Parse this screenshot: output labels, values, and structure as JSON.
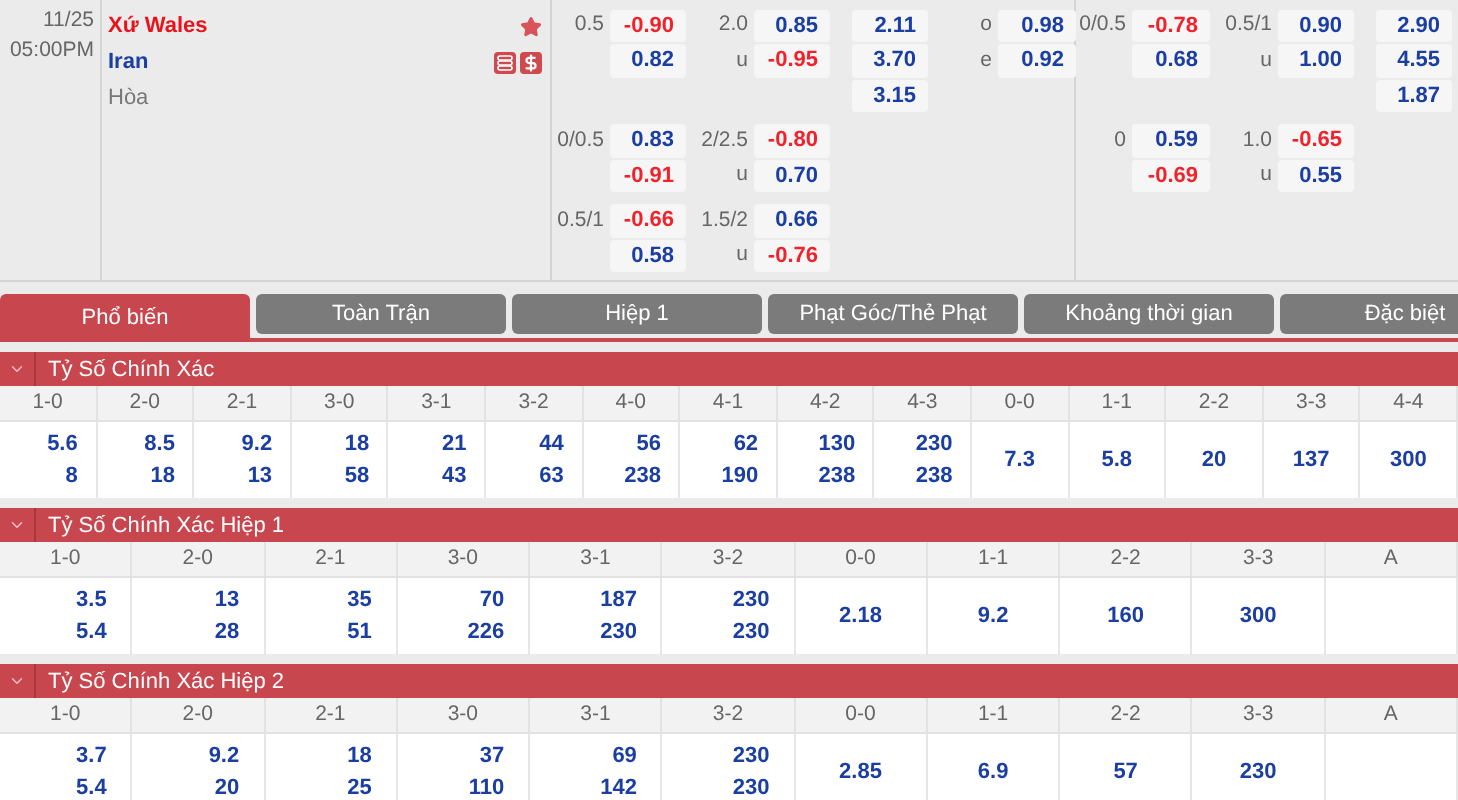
{
  "match": {
    "date": "11/25",
    "time": "05:00PM",
    "entries": [
      {
        "kind": "team",
        "name": "Xứ Wales",
        "color": "#e8141c"
      },
      {
        "kind": "team",
        "name": "Iran",
        "color": "#1b3ea3"
      },
      {
        "kind": "draw",
        "name": "Hòa",
        "color": "#777777"
      }
    ]
  },
  "full_time": {
    "groups": [
      {
        "handicap": {
          "line": "0.5",
          "odds": [
            {
              "value": "-0.90",
              "negative": true
            },
            {
              "value": "0.82",
              "negative": false
            }
          ]
        },
        "total": {
          "line": "2.0",
          "under": "u",
          "odds": [
            {
              "value": "0.85",
              "negative": false
            },
            {
              "value": "-0.95",
              "negative": true
            }
          ]
        },
        "one_x_two": [
          {
            "value": "2.11",
            "negative": false
          },
          {
            "value": "3.70",
            "negative": false
          },
          {
            "value": "3.15",
            "negative": false
          }
        ],
        "odd_even": [
          {
            "label": "o",
            "value": "0.98",
            "negative": false
          },
          {
            "label": "e",
            "value": "0.92",
            "negative": false
          }
        ]
      },
      {
        "handicap": {
          "line": "0/0.5",
          "odds": [
            {
              "value": "0.83",
              "negative": false
            },
            {
              "value": "-0.91",
              "negative": true
            }
          ]
        },
        "total": {
          "line": "2/2.5",
          "under": "u",
          "odds": [
            {
              "value": "-0.80",
              "negative": true
            },
            {
              "value": "0.70",
              "negative": false
            }
          ]
        }
      },
      {
        "handicap": {
          "line": "0.5/1",
          "odds": [
            {
              "value": "-0.66",
              "negative": true
            },
            {
              "value": "0.58",
              "negative": false
            }
          ]
        },
        "total": {
          "line": "1.5/2",
          "under": "u",
          "odds": [
            {
              "value": "0.66",
              "negative": false
            },
            {
              "value": "-0.76",
              "negative": true
            }
          ]
        }
      }
    ]
  },
  "first_half": {
    "groups": [
      {
        "handicap": {
          "line": "0/0.5",
          "odds": [
            {
              "value": "-0.78",
              "negative": true
            },
            {
              "value": "0.68",
              "negative": false
            }
          ]
        },
        "total": {
          "line": "0.5/1",
          "under": "u",
          "odds": [
            {
              "value": "0.90",
              "negative": false
            },
            {
              "value": "1.00",
              "negative": false
            }
          ]
        },
        "one_x_two": [
          {
            "value": "2.90",
            "negative": false
          },
          {
            "value": "4.55",
            "negative": false
          },
          {
            "value": "1.87",
            "negative": false
          }
        ]
      },
      {
        "handicap": {
          "line": "0",
          "odds": [
            {
              "value": "0.59",
              "negative": false
            },
            {
              "value": "-0.69",
              "negative": true
            }
          ]
        },
        "total": {
          "line": "1.0",
          "under": "u",
          "odds": [
            {
              "value": "-0.65",
              "negative": true
            },
            {
              "value": "0.55",
              "negative": false
            }
          ]
        }
      }
    ]
  },
  "tabs": [
    {
      "label": "Phổ biến",
      "selected": true
    },
    {
      "label": "Toàn Trận",
      "selected": false
    },
    {
      "label": "Hiệp 1",
      "selected": false
    },
    {
      "label": "Phạt Góc/Thẻ Phạt",
      "selected": false
    },
    {
      "label": "Khoảng thời gian",
      "selected": false
    },
    {
      "label": "Đặc biệt",
      "selected": false
    }
  ],
  "sections": [
    {
      "title": "Tỷ Số Chính Xác",
      "expanded": true,
      "columns": [
        {
          "label": "1-0",
          "values": [
            "5.6",
            "8"
          ]
        },
        {
          "label": "2-0",
          "values": [
            "8.5",
            "18"
          ]
        },
        {
          "label": "2-1",
          "values": [
            "9.2",
            "13"
          ]
        },
        {
          "label": "3-0",
          "values": [
            "18",
            "58"
          ]
        },
        {
          "label": "3-1",
          "values": [
            "21",
            "43"
          ]
        },
        {
          "label": "3-2",
          "values": [
            "44",
            "63"
          ]
        },
        {
          "label": "4-0",
          "values": [
            "56",
            "238"
          ]
        },
        {
          "label": "4-1",
          "values": [
            "62",
            "190"
          ]
        },
        {
          "label": "4-2",
          "values": [
            "130",
            "238"
          ]
        },
        {
          "label": "4-3",
          "values": [
            "230",
            "238"
          ]
        },
        {
          "label": "0-0",
          "values": [
            "7.3"
          ]
        },
        {
          "label": "1-1",
          "values": [
            "5.8"
          ]
        },
        {
          "label": "2-2",
          "values": [
            "20"
          ]
        },
        {
          "label": "3-3",
          "values": [
            "137"
          ]
        },
        {
          "label": "4-4",
          "values": [
            "300"
          ]
        }
      ]
    },
    {
      "title": "Tỷ Số Chính Xác Hiệp 1",
      "expanded": true,
      "columns": [
        {
          "label": "1-0",
          "values": [
            "3.5",
            "5.4"
          ]
        },
        {
          "label": "2-0",
          "values": [
            "13",
            "28"
          ]
        },
        {
          "label": "2-1",
          "values": [
            "35",
            "51"
          ]
        },
        {
          "label": "3-0",
          "values": [
            "70",
            "226"
          ]
        },
        {
          "label": "3-1",
          "values": [
            "187",
            "230"
          ]
        },
        {
          "label": "3-2",
          "values": [
            "230",
            "230"
          ]
        },
        {
          "label": "0-0",
          "values": [
            "2.18"
          ]
        },
        {
          "label": "1-1",
          "values": [
            "9.2"
          ]
        },
        {
          "label": "2-2",
          "values": [
            "160"
          ]
        },
        {
          "label": "3-3",
          "values": [
            "300"
          ]
        },
        {
          "label": "A"
        }
      ]
    },
    {
      "title": "Tỷ Số Chính Xác Hiệp 2",
      "expanded": true,
      "columns": [
        {
          "label": "1-0",
          "values": [
            "3.7",
            "5.4"
          ]
        },
        {
          "label": "2-0",
          "values": [
            "9.2",
            "20"
          ]
        },
        {
          "label": "2-1",
          "values": [
            "18",
            "25"
          ]
        },
        {
          "label": "3-0",
          "values": [
            "37",
            "110"
          ]
        },
        {
          "label": "3-1",
          "values": [
            "69",
            "142"
          ]
        },
        {
          "label": "3-2",
          "values": [
            "230",
            "230"
          ]
        },
        {
          "label": "0-0",
          "values": [
            "2.85"
          ]
        },
        {
          "label": "1-1",
          "values": [
            "6.9"
          ]
        },
        {
          "label": "2-2",
          "values": [
            "57"
          ]
        },
        {
          "label": "3-3",
          "values": [
            "230"
          ]
        },
        {
          "label": "A"
        }
      ]
    }
  ]
}
